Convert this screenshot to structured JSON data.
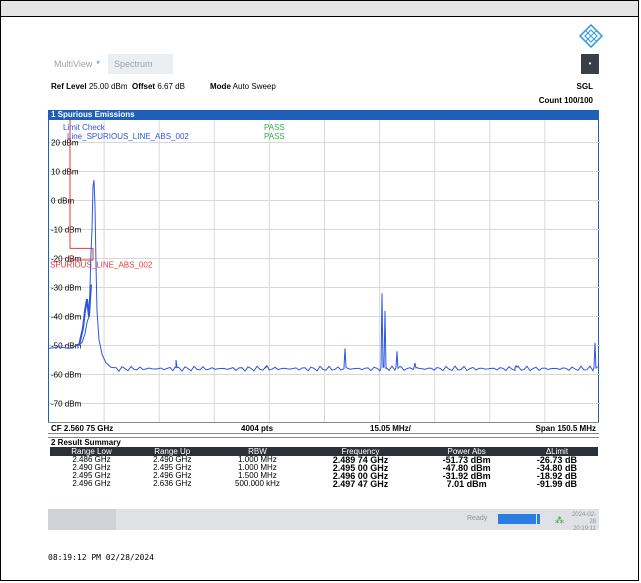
{
  "tabs": {
    "multiview": "MultiView",
    "spectrum": "Spectrum",
    "star": "*"
  },
  "info": {
    "ref_level_label": "Ref Level",
    "ref_level_value": "25.00 dBm",
    "offset_label": "Offset",
    "offset_value": "6.67 dB",
    "mode_label": "Mode",
    "mode_value": "Auto Sweep",
    "sgl": "SGL",
    "count": "Count 100/100"
  },
  "window_title": "1 Spurious Emissions",
  "chart_data": {
    "type": "line",
    "y_ticks": [
      "20 dBm",
      "10 dBm",
      "0 dBm",
      "-10 dBm",
      "-20 dBm",
      "-30 dBm",
      "-40 dBm",
      "-50 dBm",
      "-60 dBm",
      "-70 dBm"
    ],
    "ylim": [
      -75,
      25
    ],
    "limit_check_label": "Limit Check",
    "line_label": "Line_SPURIOUS_LINE_ABS_002",
    "pass1": "PASS",
    "pass2": "PASS",
    "limit_line_label": "SPURIOUS_LINE_ABS_002",
    "trace_color": "#2f55e0",
    "limit_color": "#e03a3a",
    "x_start": "CF 2.560 75 GHz",
    "points": "4004 pts",
    "x_div": "15.05 MHz/",
    "span": "Span 150.5 MHz"
  },
  "results": {
    "title": "2 Result Summary",
    "headers": [
      "Range Low",
      "Range Up",
      "RBW",
      "Frequency",
      "Power Abs",
      "ΔLimit"
    ],
    "rows": [
      [
        "2.486 GHz",
        "2.490 GHz",
        "1.000 MHz",
        "2.489 74 GHz",
        "-51.73 dBm",
        "-26.73 dB"
      ],
      [
        "2.490 GHz",
        "2.495 GHz",
        "1.000 MHz",
        "2.495 00 GHz",
        "-47.80 dBm",
        "-34.80 dB"
      ],
      [
        "2.495 GHz",
        "2.496 GHz",
        "1.500 MHz",
        "2.496 00 GHz",
        "-31.92 dBm",
        "-18.92 dB"
      ],
      [
        "2.496 GHz",
        "2.636 GHz",
        "500.000 kHz",
        "2.497 47 GHz",
        "7.01 dBm",
        "-91.99 dB"
      ]
    ]
  },
  "status": {
    "ready": "Ready",
    "date": "2024-02-28",
    "time": "20:19:11"
  },
  "timestamp": "08:19:12 PM  02/28/2024"
}
